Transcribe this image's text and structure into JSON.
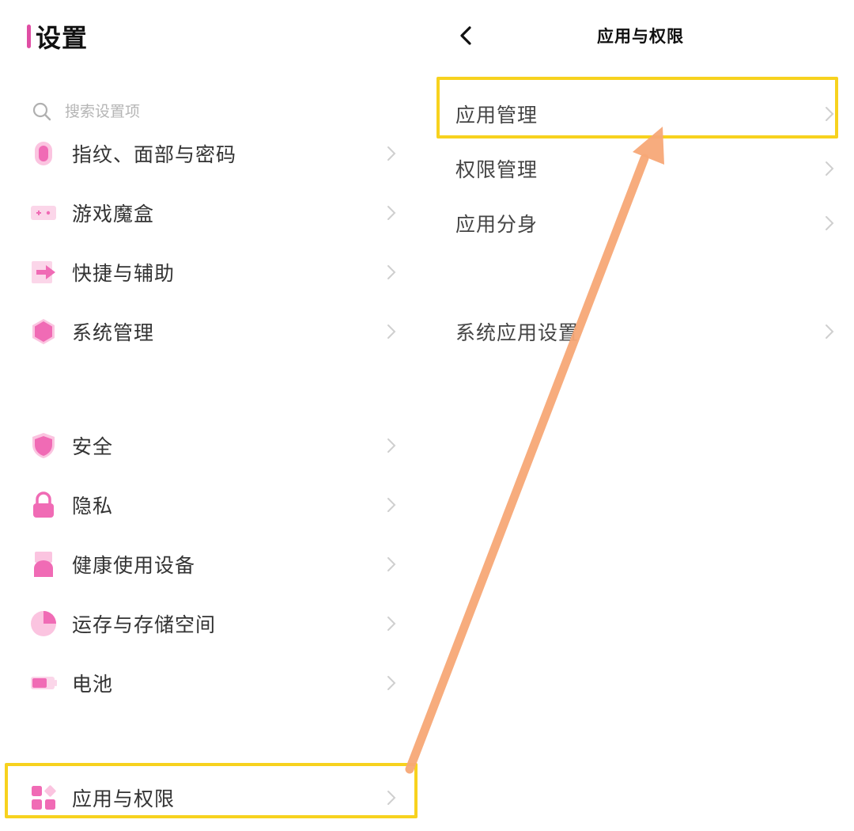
{
  "settings": {
    "title": "设置",
    "search_placeholder": "搜索设置项",
    "items": [
      {
        "label": "指纹、面部与密码",
        "icon": "fingerprint-icon"
      },
      {
        "label": "游戏魔盒",
        "icon": "gamepad-icon"
      },
      {
        "label": "快捷与辅助",
        "icon": "shortcut-icon"
      },
      {
        "label": "系统管理",
        "icon": "system-hexagon-icon"
      },
      {
        "label": "安全",
        "icon": "shield-icon"
      },
      {
        "label": "隐私",
        "icon": "lock-icon"
      },
      {
        "label": "健康使用设备",
        "icon": "health-icon"
      },
      {
        "label": "运存与存储空间",
        "icon": "storage-pie-icon"
      },
      {
        "label": "电池",
        "icon": "battery-icon"
      },
      {
        "label": "应用与权限",
        "icon": "apps-grid-icon"
      }
    ]
  },
  "apps_permissions": {
    "title": "应用与权限",
    "items": [
      {
        "label": "应用管理"
      },
      {
        "label": "权限管理"
      },
      {
        "label": "应用分身"
      },
      {
        "label": "系统应用设置"
      }
    ]
  },
  "colors": {
    "icon_pink": "#f06bb5",
    "icon_pink_light": "#fbc4e0",
    "highlight": "#f7d21e",
    "arrow": "#f7a877"
  }
}
